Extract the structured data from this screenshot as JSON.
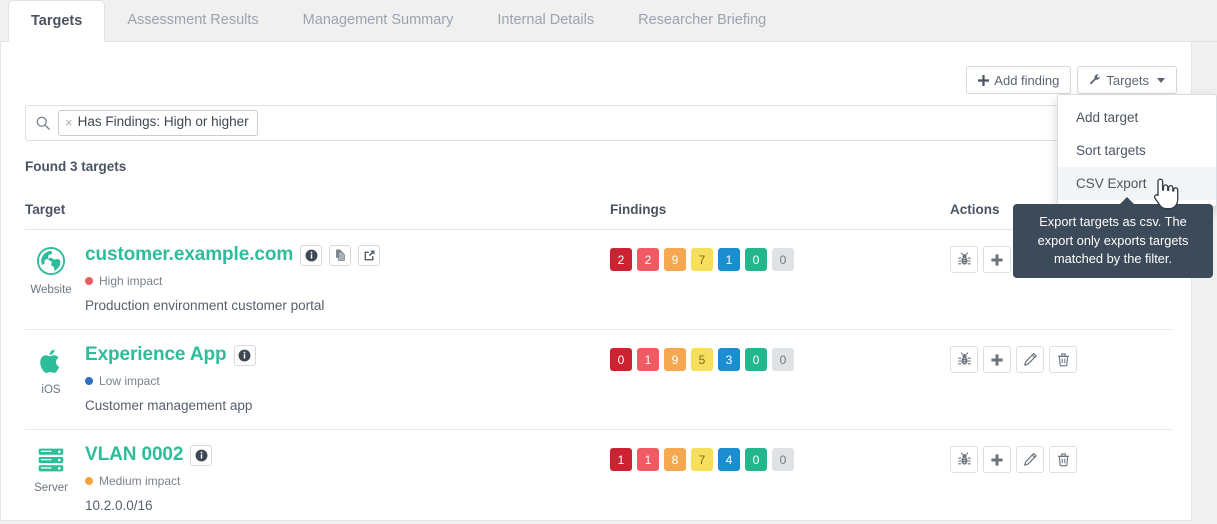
{
  "tabs": [
    {
      "label": "Targets",
      "active": true
    },
    {
      "label": "Assessment Results",
      "active": false
    },
    {
      "label": "Management Summary",
      "active": false
    },
    {
      "label": "Internal Details",
      "active": false
    },
    {
      "label": "Researcher Briefing",
      "active": false
    }
  ],
  "toolbar": {
    "add_finding_label": "Add finding",
    "targets_label": "Targets"
  },
  "dropdown": {
    "items": [
      {
        "label": "Add target",
        "hover": false
      },
      {
        "label": "Sort targets",
        "hover": false
      },
      {
        "label": "CSV Export",
        "hover": true
      }
    ]
  },
  "tooltip": {
    "text": "Export targets as csv. The export only exports targets matched by the filter."
  },
  "search": {
    "placeholder": "",
    "value": "",
    "chip_label": "Has Findings: High or higher",
    "chip_remove": "×"
  },
  "results": {
    "found_label": "Found 3 targets"
  },
  "table": {
    "headers": {
      "target": "Target",
      "findings": "Findings",
      "actions": "Actions"
    },
    "rows": [
      {
        "type_label": "Website",
        "type_icon": "globe-icon",
        "title": "customer.example.com",
        "impact": "High impact",
        "impact_color": "#ef5a63",
        "description": "Production environment customer portal",
        "title_buttons": [
          "info-icon",
          "copy-icon",
          "external-link-icon"
        ],
        "findings": [
          {
            "count": "2",
            "color": "#cd2231"
          },
          {
            "count": "2",
            "color": "#ef5a63"
          },
          {
            "count": "9",
            "color": "#f5a84f"
          },
          {
            "count": "7",
            "color": "#f7df5e"
          },
          {
            "count": "1",
            "color": "#1b8dd1"
          },
          {
            "count": "0",
            "color": "#24b78e"
          },
          {
            "count": "0",
            "color": "#dfe3e6"
          }
        ],
        "actions": [
          "bug-icon",
          "plus-icon",
          "pencil-icon",
          "trash-icon"
        ]
      },
      {
        "type_label": "iOS",
        "type_icon": "apple-icon",
        "title": "Experience App",
        "impact": "Low impact",
        "impact_color": "#2f6fc4",
        "description": "Customer management app",
        "title_buttons": [
          "info-icon"
        ],
        "findings": [
          {
            "count": "0",
            "color": "#cd2231"
          },
          {
            "count": "1",
            "color": "#ef5a63"
          },
          {
            "count": "9",
            "color": "#f5a84f"
          },
          {
            "count": "5",
            "color": "#f7df5e"
          },
          {
            "count": "3",
            "color": "#1b8dd1"
          },
          {
            "count": "0",
            "color": "#24b78e"
          },
          {
            "count": "0",
            "color": "#dfe3e6"
          }
        ],
        "actions": [
          "bug-icon",
          "plus-icon",
          "pencil-icon",
          "trash-icon"
        ]
      },
      {
        "type_label": "Server",
        "type_icon": "server-icon",
        "title": "VLAN 0002",
        "impact": "Medium impact",
        "impact_color": "#f2a33c",
        "description": "10.2.0.0/16",
        "title_buttons": [
          "info-icon"
        ],
        "findings": [
          {
            "count": "1",
            "color": "#cd2231"
          },
          {
            "count": "1",
            "color": "#ef5a63"
          },
          {
            "count": "8",
            "color": "#f5a84f"
          },
          {
            "count": "7",
            "color": "#f7df5e"
          },
          {
            "count": "4",
            "color": "#1b8dd1"
          },
          {
            "count": "0",
            "color": "#24b78e"
          },
          {
            "count": "0",
            "color": "#dfe3e6"
          }
        ],
        "actions": [
          "bug-icon",
          "plus-icon",
          "pencil-icon",
          "trash-icon"
        ]
      }
    ]
  },
  "colors": {
    "accent_green": "#2dbd9a",
    "tooltip_bg": "#3c4a59"
  }
}
